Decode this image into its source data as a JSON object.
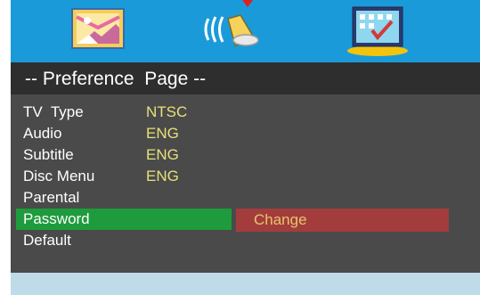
{
  "tabs": [
    {
      "name": "video-settings-tab",
      "icon": "picture-icon",
      "active": false
    },
    {
      "name": "audio-settings-tab",
      "icon": "speaker-icon",
      "active": false
    },
    {
      "name": "preference-settings-tab",
      "icon": "checklist-icon",
      "active": true
    }
  ],
  "colors": {
    "tabbar": "#1a9ad9",
    "title_bar": "#2e2e2e",
    "menu_bg": "#4a4a4a",
    "selected_row": "#1e9b3c",
    "submenu_bg": "#a33d3d",
    "value_text": "#e8e07a",
    "submenu_text": "#e8c46a",
    "bottom_strip": "#bfdbe8"
  },
  "page": {
    "title": "-- Preference  Page --"
  },
  "menu": {
    "items": [
      {
        "label": "TV  Type",
        "value": "NTSC"
      },
      {
        "label": "Audio",
        "value": "ENG"
      },
      {
        "label": "Subtitle",
        "value": "ENG"
      },
      {
        "label": "Disc Menu",
        "value": "ENG"
      },
      {
        "label": "Parental",
        "value": ""
      },
      {
        "label": "Password",
        "value": "",
        "selected": true
      },
      {
        "label": "Default",
        "value": ""
      }
    ]
  },
  "submenu": {
    "option": "Change"
  }
}
